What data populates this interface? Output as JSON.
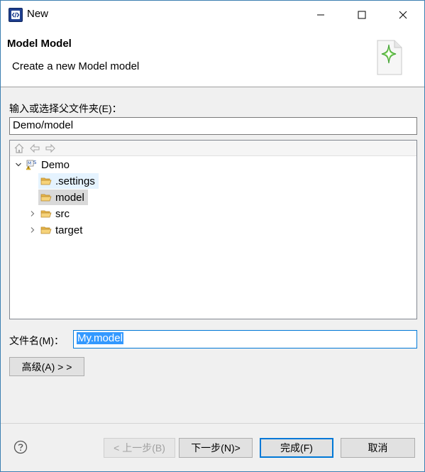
{
  "window": {
    "title": "New",
    "controls": {
      "minimize_icon": "minimize-icon",
      "maximize_icon": "maximize-icon",
      "close_icon": "close-icon"
    }
  },
  "banner": {
    "title": "Model Model",
    "description": "Create a new Model model",
    "icon": "new-file-wizard-icon"
  },
  "folder": {
    "label": "输入或选择父文件夹(E)：",
    "value": "Demo/model"
  },
  "tree": {
    "toolbar_icons": [
      "home-icon",
      "back-icon",
      "forward-icon"
    ],
    "items": [
      {
        "label": "Demo",
        "icon": "project-icon",
        "expanded": true,
        "level": 0
      },
      {
        "label": ".settings",
        "icon": "folder-open-icon",
        "level": 1
      },
      {
        "label": "model",
        "icon": "folder-open-icon",
        "level": 1,
        "selected": true
      },
      {
        "label": "src",
        "icon": "folder-icon",
        "level": 1,
        "expandable": true
      },
      {
        "label": "target",
        "icon": "folder-icon",
        "level": 1,
        "expandable": true
      }
    ]
  },
  "filename": {
    "label": "文件名(M)：",
    "value": "My.model"
  },
  "advanced_button": "高级(A) > >",
  "footer": {
    "back": "< 上一步(B)",
    "next": "下一步(N)>",
    "finish": "完成(F)",
    "cancel": "取消"
  },
  "colors": {
    "accent": "#0078d7",
    "selection": "#3399ff",
    "folder": "#e8b84a"
  }
}
